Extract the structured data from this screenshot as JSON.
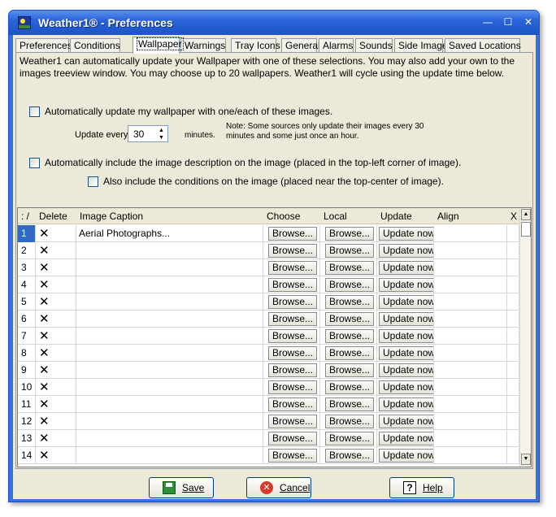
{
  "window": {
    "title": "Weather1® - Preferences",
    "min_glyph": "—",
    "max_glyph": "☐",
    "close_glyph": "✕"
  },
  "tabs": [
    {
      "label": "Preferences"
    },
    {
      "label": "Conditions"
    },
    {
      "label": "Wallpaper"
    },
    {
      "label": "Warnings"
    },
    {
      "label": "Tray Icons"
    },
    {
      "label": "General"
    },
    {
      "label": "Alarms"
    },
    {
      "label": "Sounds"
    },
    {
      "label": "Side Image"
    },
    {
      "label": "Saved Locations"
    }
  ],
  "active_tab": "Wallpaper",
  "wallpaper": {
    "intro": "Weather1 can automatically update your Wallpaper with one of these selections.  You may also add your own to the images treeview window.  You may choose up to 20 wallpapers.  Weather1 will cycle using the update time below.",
    "auto_update_label": "Automatically update my wallpaper with one/each of these images.",
    "auto_update_checked": false,
    "update_every_label": "Update every",
    "update_every_value": "30",
    "minutes_label": "minutes.",
    "note": "Note:  Some sources only update their images every 30 minutes and some just once an hour.",
    "include_desc_label": "Automatically include the image description on the image  (placed in the top-left corner of image).",
    "include_desc_checked": false,
    "include_cond_label": "Also include the conditions on the image  (placed near the top-center of image).",
    "include_cond_checked": false
  },
  "grid": {
    "headers": {
      "num": ": /",
      "delete": "Delete",
      "caption": "Image Caption",
      "choose": "Choose",
      "local": "Local",
      "update": "Update",
      "align": "Align",
      "x": "X"
    },
    "delete_glyph": "✕",
    "browse_label": "Browse...",
    "update_now_label": "Update now",
    "rows": [
      {
        "num": "1",
        "caption": "Aerial Photographs..."
      },
      {
        "num": "2",
        "caption": ""
      },
      {
        "num": "3",
        "caption": ""
      },
      {
        "num": "4",
        "caption": ""
      },
      {
        "num": "5",
        "caption": ""
      },
      {
        "num": "6",
        "caption": ""
      },
      {
        "num": "7",
        "caption": ""
      },
      {
        "num": "8",
        "caption": ""
      },
      {
        "num": "9",
        "caption": ""
      },
      {
        "num": "10",
        "caption": ""
      },
      {
        "num": "11",
        "caption": ""
      },
      {
        "num": "12",
        "caption": ""
      },
      {
        "num": "13",
        "caption": ""
      },
      {
        "num": "14",
        "caption": ""
      }
    ],
    "selected_row": "1"
  },
  "buttons": {
    "save": "Save",
    "cancel": "Cancel",
    "help": "Help",
    "cancel_glyph": "✕",
    "help_glyph": "?"
  },
  "scroll_up_glyph": "▲",
  "scroll_down_glyph": "▼",
  "spin_up_glyph": "▲",
  "spin_down_glyph": "▼"
}
